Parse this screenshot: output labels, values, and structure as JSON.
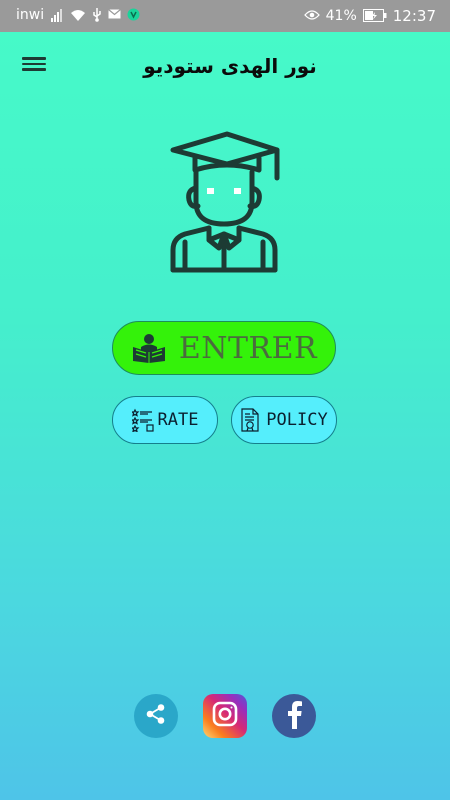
{
  "status_bar": {
    "carrier": "inwi",
    "battery": "41%",
    "time": "12:37"
  },
  "header": {
    "title": "نور الهدى ستوديو"
  },
  "buttons": {
    "enter_label": "ENTRER",
    "rate_label": "RATE",
    "policy_label": "POLICY"
  },
  "social": {
    "items": [
      "share",
      "instagram",
      "facebook"
    ]
  },
  "colors": {
    "background_top": "#46fbc8",
    "background_bottom": "#4ec4e8",
    "enter_button": "#34f20a",
    "small_buttons": "#55eefc",
    "icon_dark": "#1d3b34",
    "facebook": "#3b5998",
    "share": "#2aa7c9"
  }
}
